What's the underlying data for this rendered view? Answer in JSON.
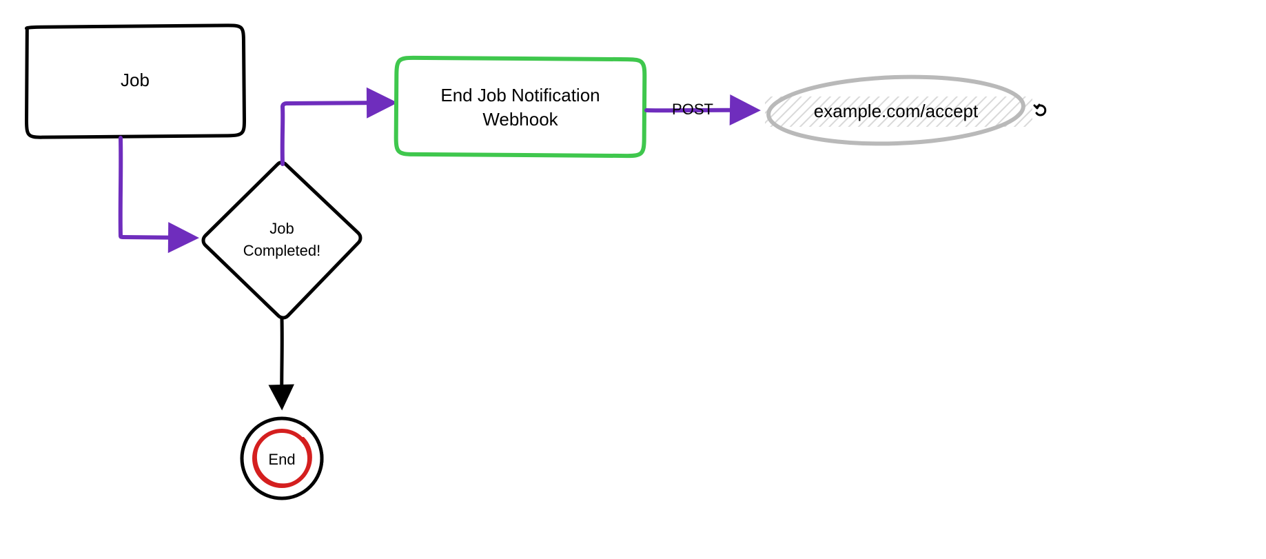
{
  "nodes": {
    "job": {
      "label": "Job"
    },
    "completed": {
      "line1": "Job",
      "line2": "Completed!"
    },
    "webhook": {
      "line1": "End Job Notification",
      "line2": "Webhook"
    },
    "endpoint": {
      "label": "example.com/accept"
    },
    "end": {
      "label": "End"
    }
  },
  "edges": {
    "post": {
      "label": "POST"
    }
  },
  "colors": {
    "purple": "#6f2dbd",
    "green": "#3fc74d",
    "red": "#d41f1f",
    "black": "#000000",
    "grey": "#b9b9b9"
  }
}
